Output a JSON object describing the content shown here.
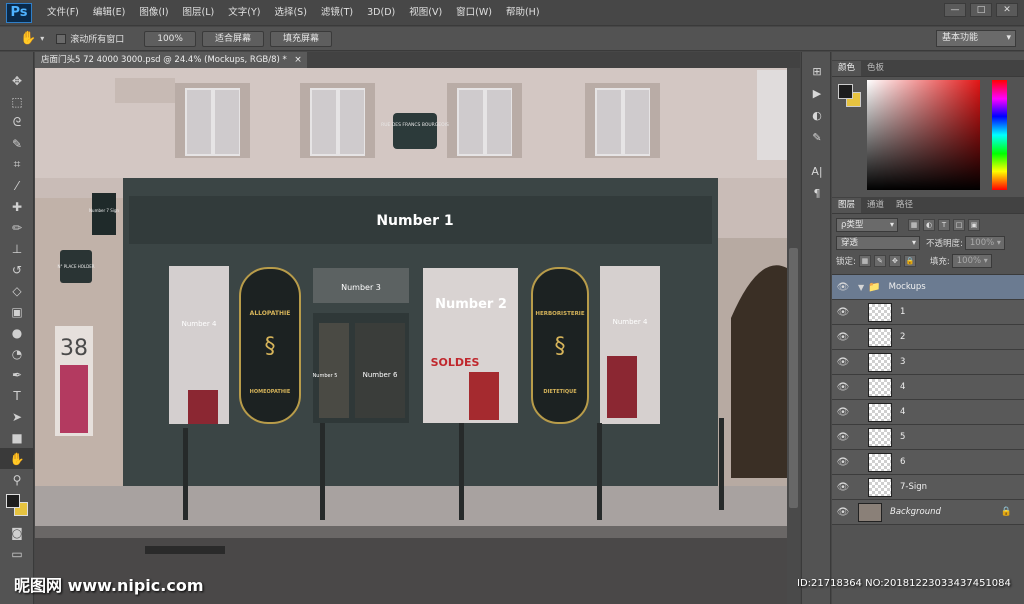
{
  "app": {
    "logo": "Ps"
  },
  "menus": [
    "文件(F)",
    "编辑(E)",
    "图像(I)",
    "图层(L)",
    "文字(Y)",
    "选择(S)",
    "滤镜(T)",
    "3D(D)",
    "视图(V)",
    "窗口(W)",
    "帮助(H)"
  ],
  "window_controls": {
    "minimize": "—",
    "restore": "□",
    "close": "✕"
  },
  "options": {
    "scroll_all_label": "滚动所有窗口",
    "zoom_100": "100%",
    "fit_screen": "适合屏幕",
    "fill_screen": "填充屏幕",
    "workspace": "基本功能"
  },
  "document": {
    "tab_title": "店面门头5 72 4000 3000.psd @ 24.4% (Mockups, RGB/8) *",
    "close": "×"
  },
  "canvas": {
    "sign_main": "Number 1",
    "window_left": "Number 4",
    "transom": "Number 3",
    "window_center": "Number 2",
    "window_right": "Number 4",
    "door": "Number 6",
    "door_left": "Number 5",
    "panel_left_top": "ALLOPATHIE",
    "panel_left_bottom": "HOMEOPATHIE",
    "panel_right_top": "HERBORISTERIE",
    "panel_right_bottom": "DIETETIQUE",
    "sale_text": "SOLDES",
    "house_number": "38",
    "street_sign": "RUE DES FRANCS BOURGEOIS",
    "hanging_sign": "Number 7 Sign",
    "small_sign": "N° PLACE HOLDER"
  },
  "color_panel": {
    "tabs": [
      "颜色",
      "色板"
    ]
  },
  "layers_panel": {
    "tabs": [
      "图层",
      "通道",
      "路径"
    ],
    "filter_kind": "ρ类型",
    "blend_mode": "穿透",
    "opacity_label": "不透明度:",
    "opacity_value": "100%",
    "lock_label": "锁定:",
    "fill_label": "填充:",
    "fill_value": "100%",
    "layers": [
      {
        "name": "Mockups",
        "type": "group"
      },
      {
        "name": "1"
      },
      {
        "name": "2"
      },
      {
        "name": "3"
      },
      {
        "name": "4"
      },
      {
        "name": "4"
      },
      {
        "name": "5"
      },
      {
        "name": "6"
      },
      {
        "name": "7-Sign"
      },
      {
        "name": "Background",
        "type": "background"
      }
    ]
  },
  "watermark": {
    "left": "昵图网 www.nipic.com",
    "right": "ID:21718364 NO:20181223033437451084"
  }
}
